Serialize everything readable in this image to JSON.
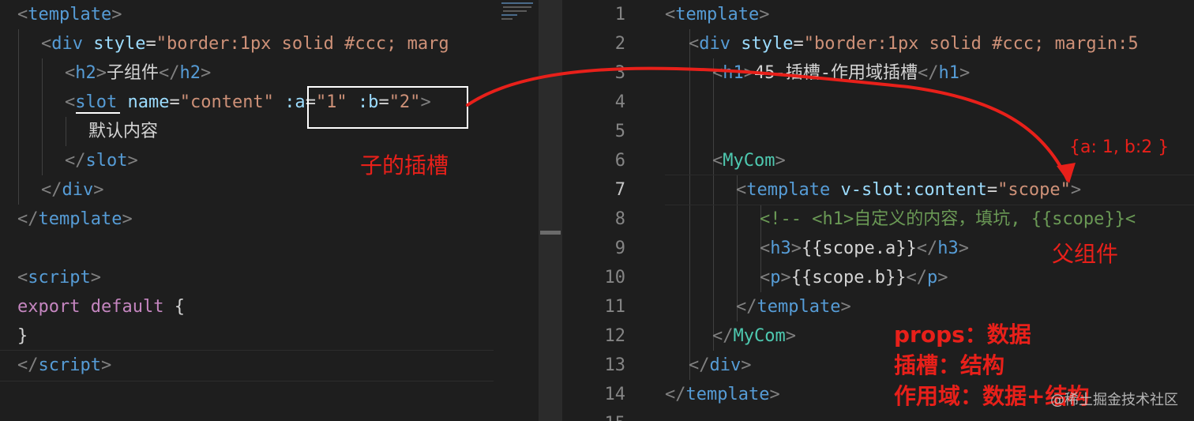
{
  "left_editor": {
    "l1": {
      "open": "<",
      "tag": "template",
      "close": ">"
    },
    "l2": {
      "open": "<",
      "tag": "div",
      "attr": "style",
      "eq": "=",
      "val": "\"border:1px solid #ccc; marg"
    },
    "l3": {
      "open": "<",
      "tag": "h2",
      "close": ">",
      "text": "子组件",
      "open2": "</",
      "tag2": "h2",
      "close2": ">"
    },
    "l4": {
      "open": "<",
      "tag": "slot",
      "attr1": "name",
      "eq": "=",
      "val1": "\"content\"",
      "attr2": ":a",
      "val2": "\"1\"",
      "attr3": ":b",
      "val3": "\"2\"",
      "close": ">"
    },
    "l5": {
      "text": "默认内容"
    },
    "l6": {
      "open": "</",
      "tag": "slot",
      "close": ">"
    },
    "l7": {
      "open": "</",
      "tag": "div",
      "close": ">"
    },
    "l8": {
      "open": "</",
      "tag": "template",
      "close": ">"
    },
    "l10": {
      "open": "<",
      "tag": "script",
      "close": ">"
    },
    "l11": {
      "kw1": "export",
      "kw2": "default",
      "brace": "{"
    },
    "l12": {
      "brace": "}"
    },
    "l13": {
      "open": "</",
      "tag": "script",
      "close": ">"
    }
  },
  "right_editor": {
    "line_numbers": [
      "1",
      "2",
      "3",
      "4",
      "5",
      "6",
      "7",
      "8",
      "9",
      "10",
      "11",
      "12",
      "13",
      "14",
      "15"
    ],
    "active_line": 7,
    "r1": {
      "open": "<",
      "tag": "template",
      "close": ">"
    },
    "r2": {
      "open": "<",
      "tag": "div",
      "attr": "style",
      "eq": "=",
      "val": "\"border:1px solid #ccc; margin:5"
    },
    "r3": {
      "open": "<",
      "tag": "h1",
      "close": ">",
      "text": "45-插槽-作用域插槽",
      "open2": "</",
      "tag2": "h1",
      "close2": ">"
    },
    "r6": {
      "open": "<",
      "tag": "MyCom",
      "close": ">"
    },
    "r7": {
      "open": "<",
      "tag": "template",
      "attr": "v-slot:content",
      "eq": "=",
      "val": "\"scope\"",
      "close": ">"
    },
    "r8": {
      "comment": "<!-- <h1>自定义的内容，填坑, {{scope}}<"
    },
    "r9": {
      "open": "<",
      "tag": "h3",
      "close": ">",
      "text": "{{scope.a}}",
      "open2": "</",
      "tag2": "h3",
      "close2": ">"
    },
    "r10": {
      "open": "<",
      "tag": "p",
      "close": ">",
      "text": "{{scope.b}}",
      "open2": "</",
      "tag2": "p",
      "close2": ">"
    },
    "r11": {
      "open": "</",
      "tag": "template",
      "close": ">"
    },
    "r12": {
      "open": "</",
      "tag": "MyCom",
      "close": ">"
    },
    "r13": {
      "open": "</",
      "tag": "div",
      "close": ">"
    },
    "r14": {
      "open": "</",
      "tag": "template",
      "close": ">"
    }
  },
  "annotations": {
    "child_slot": "子的插槽",
    "scope_value": "{a: 1, b:2 }",
    "parent_component": "父组件",
    "props_note": "props：数据",
    "slot_note": "插槽：结构",
    "scope_note": "作用域：数据+结构"
  },
  "watermark": "@稀土掘金技术社区",
  "colors": {
    "background": "#1e1e1e",
    "annotation_red": "#e8201a",
    "tag_blue": "#569cd6",
    "attr_lightblue": "#9cdcfe",
    "string_orange": "#ce9178",
    "keyword_purple": "#c586c0",
    "comment_green": "#6a9955",
    "component_teal": "#4ec9b0"
  }
}
